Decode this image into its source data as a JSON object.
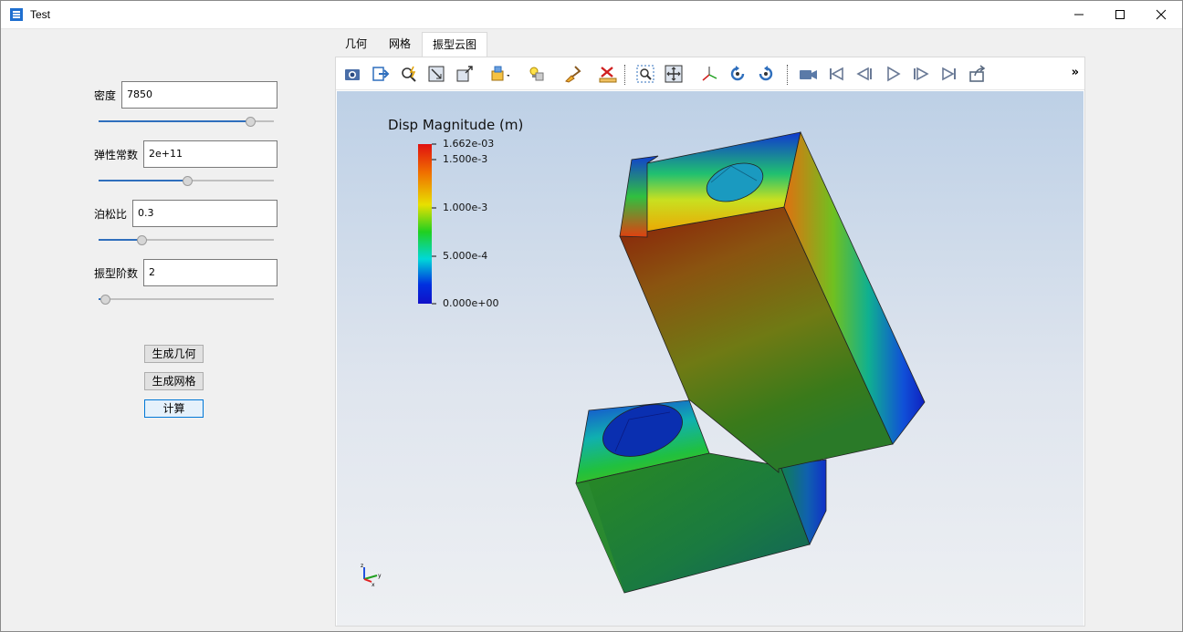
{
  "window": {
    "title": "Test"
  },
  "params": [
    {
      "label": "密度",
      "value": "7850",
      "slider": 0.87
    },
    {
      "label": "弹性常数",
      "value": "2e+11",
      "slider": 0.51
    },
    {
      "label": "泊松比",
      "value": "0.3",
      "slider": 0.25
    },
    {
      "label": "振型阶数",
      "value": "2",
      "slider": 0.04
    }
  ],
  "buttons": {
    "geometry": "生成几何",
    "mesh": "生成网格",
    "compute": "计算"
  },
  "tabs": [
    {
      "label": "几何"
    },
    {
      "label": "网格"
    },
    {
      "label": "振型云图",
      "active": true
    }
  ],
  "toolbar": {
    "icons": [
      "camera-icon",
      "export-icon",
      "zoom-data-icon",
      "reset-camera-icon",
      "zoom-closest-icon",
      "select-block-icon",
      "light-icon",
      "brush-icon",
      "ruler-icon",
      "zoom-box-icon",
      "pan-icon",
      "axes-icon",
      "rotate-ccw-icon",
      "rotate-cw-icon",
      "video-icon",
      "first-frame-icon",
      "prev-frame-icon",
      "play-icon",
      "next-frame-icon",
      "last-frame-icon",
      "share-icon"
    ],
    "more": "»"
  },
  "colorbar": {
    "title": "Disp Magnitude (m)",
    "ticks": [
      "1.662e-03",
      "1.500e-3",
      "1.000e-3",
      "5.000e-4",
      "0.000e+00"
    ],
    "tick_values": [
      0.001662,
      0.0015,
      0.001,
      0.0005,
      0.0
    ],
    "max": 0.001662,
    "colors": [
      "#e01010",
      "#f07000",
      "#e8e000",
      "#20d020",
      "#00d8d8",
      "#0030e0",
      "#1010c8"
    ]
  },
  "axes_indicator": {
    "labels": [
      "z",
      "y",
      "x"
    ]
  }
}
